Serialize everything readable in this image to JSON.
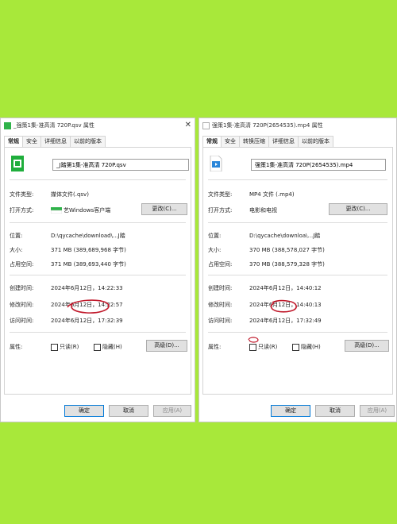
{
  "left": {
    "title": "_强策1集-准高清 720P.qsv 属性",
    "tabs": [
      "常规",
      "安全",
      "详细信息",
      "以前的版本"
    ],
    "filename": "_J踏第1集-准高清 720P.qsv",
    "file_type_label": "文件类型:",
    "file_type_value": "媒体文件(.qsv)",
    "open_with_label": "打开方式:",
    "open_with_value": "艺Windows客户端",
    "change_button": "更改(C)...",
    "location_label": "位置:",
    "location_value": "D:\\qycache\\download\\...J踏",
    "size_label": "大小:",
    "size_value": "371 MB (389,689,968 字节)",
    "disk_size_label": "占用空间:",
    "disk_size_value": "371 MB (389,693,440 字节)",
    "created_label": "创建时间:",
    "created_value": "2024年6月12日，14:22:33",
    "modified_label": "修改时间:",
    "modified_value": "2024年6月12日，14:22:57",
    "accessed_label": "访问时间:",
    "accessed_value": "2024年6月12日，17:32:39",
    "attributes_label": "属性:",
    "readonly_label": "只读(R)",
    "hidden_label": "隐藏(H)",
    "advanced_button": "高级(D)...",
    "ok_button": "确定",
    "cancel_button": "取消",
    "apply_button": "应用(A)"
  },
  "right": {
    "title": "强策1集-准高清 720P(2654535).mp4 属性",
    "tabs": [
      "常规",
      "安全",
      "转换压缩",
      "详细信息",
      "以前的版本"
    ],
    "filename": "强策1集-准高清 720P(2654535).mp4",
    "file_type_label": "文件类型:",
    "file_type_value": "MP4 文件 (.mp4)",
    "open_with_label": "打开方式:",
    "open_with_value": "电影和电视",
    "change_button": "更改(C)...",
    "location_label": "位置:",
    "location_value": "D:\\qycache\\downloa\\...J踏",
    "size_label": "大小:",
    "size_value": "370 MB (388,578,027 字节)",
    "disk_size_label": "占用空间:",
    "disk_size_value": "370 MB (388,579,328 字节)",
    "created_label": "创建时间:",
    "created_value": "2024年6月12日，14:40:12",
    "modified_label": "修改时间:",
    "modified_value": "2024年6月12日，14:40:13",
    "accessed_label": "访问时间:",
    "accessed_value": "2024年6月12日，17:32:49",
    "attributes_label": "属性:",
    "readonly_label": "只读(R)",
    "hidden_label": "隐藏(H)",
    "advanced_button": "高级(D)...",
    "ok_button": "确定",
    "cancel_button": "取消",
    "apply_button": "应用(A)"
  },
  "colors": {
    "background": "#a8e83a",
    "annotation": "#c0182a",
    "accent": "#0078d7"
  },
  "icons": {
    "qsv_file": "green-qsv-file-icon",
    "mp4_file": "blue-mp4-file-icon"
  }
}
